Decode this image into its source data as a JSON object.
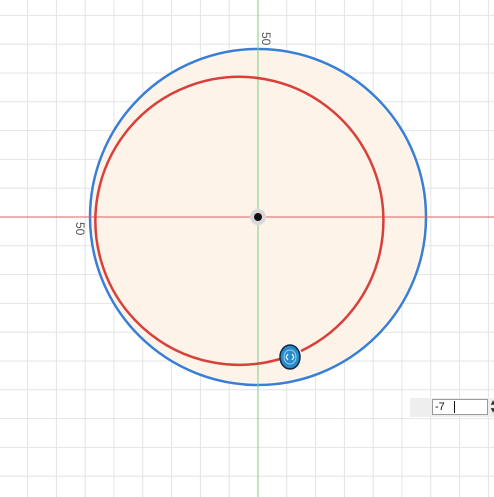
{
  "sketch": {
    "vertical_dimension_label": "50",
    "horizontal_dimension_label": "50"
  },
  "dimension_input": {
    "value": "-7"
  },
  "colors": {
    "outer_circle": "#3a7fd5",
    "inner_circle": "#d9403a",
    "disc_fill": "#fdf3e8",
    "x_axis": "#e06060",
    "y_axis": "#7ccf7c",
    "grid": "#e4e4e4",
    "handle": "#2a8ac8"
  }
}
